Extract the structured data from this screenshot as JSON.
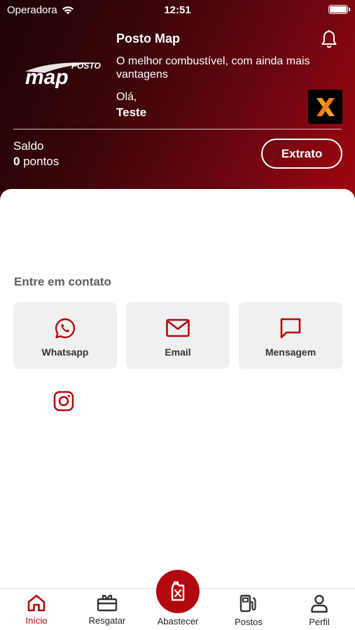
{
  "status_bar": {
    "carrier": "Operadora",
    "time": "12:51"
  },
  "header": {
    "logo_text_top": "POSTO",
    "logo_text_main": "map",
    "app_title": "Posto Map",
    "tagline": "O melhor combustível, com ainda mais vantagens",
    "greeting": "Olá,",
    "username": "Teste",
    "partner_badge": "X"
  },
  "balance": {
    "label": "Saldo",
    "value": "0",
    "unit": "pontos",
    "statement_button": "Extrato"
  },
  "contact": {
    "title": "Entre em contato",
    "cards": [
      {
        "label": "Whatsapp",
        "icon": "whatsapp-icon"
      },
      {
        "label": "Email",
        "icon": "mail-icon"
      },
      {
        "label": "Mensagem",
        "icon": "message-icon"
      }
    ],
    "instagram_icon": "instagram-icon"
  },
  "tabbar": {
    "items": [
      {
        "label": "Início",
        "icon": "home-icon",
        "active": true
      },
      {
        "label": "Resgatar",
        "icon": "gift-icon"
      },
      {
        "label": "Abastecer",
        "icon": "fuel-can-icon"
      },
      {
        "label": "Postos",
        "icon": "fuel-pump-icon"
      },
      {
        "label": "Perfil",
        "icon": "user-icon"
      }
    ]
  },
  "colors": {
    "brand_red": "#b3070f",
    "header_dark": "#1d0406",
    "header_light": "#a0060f",
    "card_bg": "#f0f0f0"
  }
}
